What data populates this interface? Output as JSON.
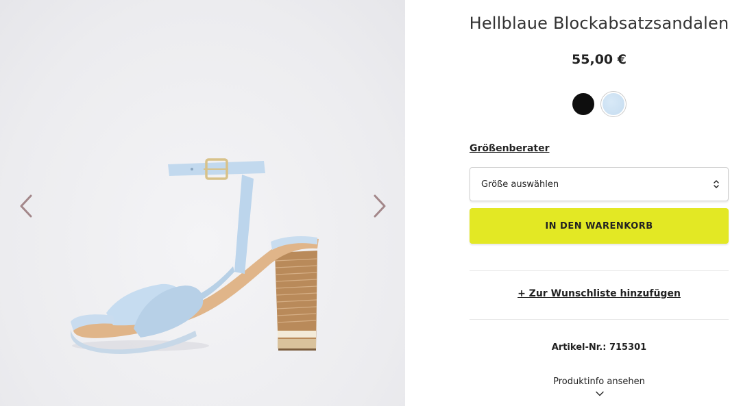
{
  "product": {
    "title": "Hellblaue Blockabsatzsandalen",
    "price": "55,00 €",
    "colors": [
      "#0e0e0e",
      "#cfe3f4"
    ],
    "size_guide_label": "Größenberater",
    "size_select_placeholder": "Größe auswählen",
    "add_to_cart_label": "IN DEN WARENKORB",
    "wishlist_label": "+ Zur Wunschliste hinzufügen",
    "article_number": "Artikel-Nr.: 715301",
    "product_info_label": "Produktinfo ansehen"
  },
  "gallery": {
    "prev_icon": "chevron-left-icon",
    "next_icon": "chevron-right-icon"
  },
  "accent": {
    "cart_button": "#e3e824",
    "arrow_color": "#a3878a"
  }
}
